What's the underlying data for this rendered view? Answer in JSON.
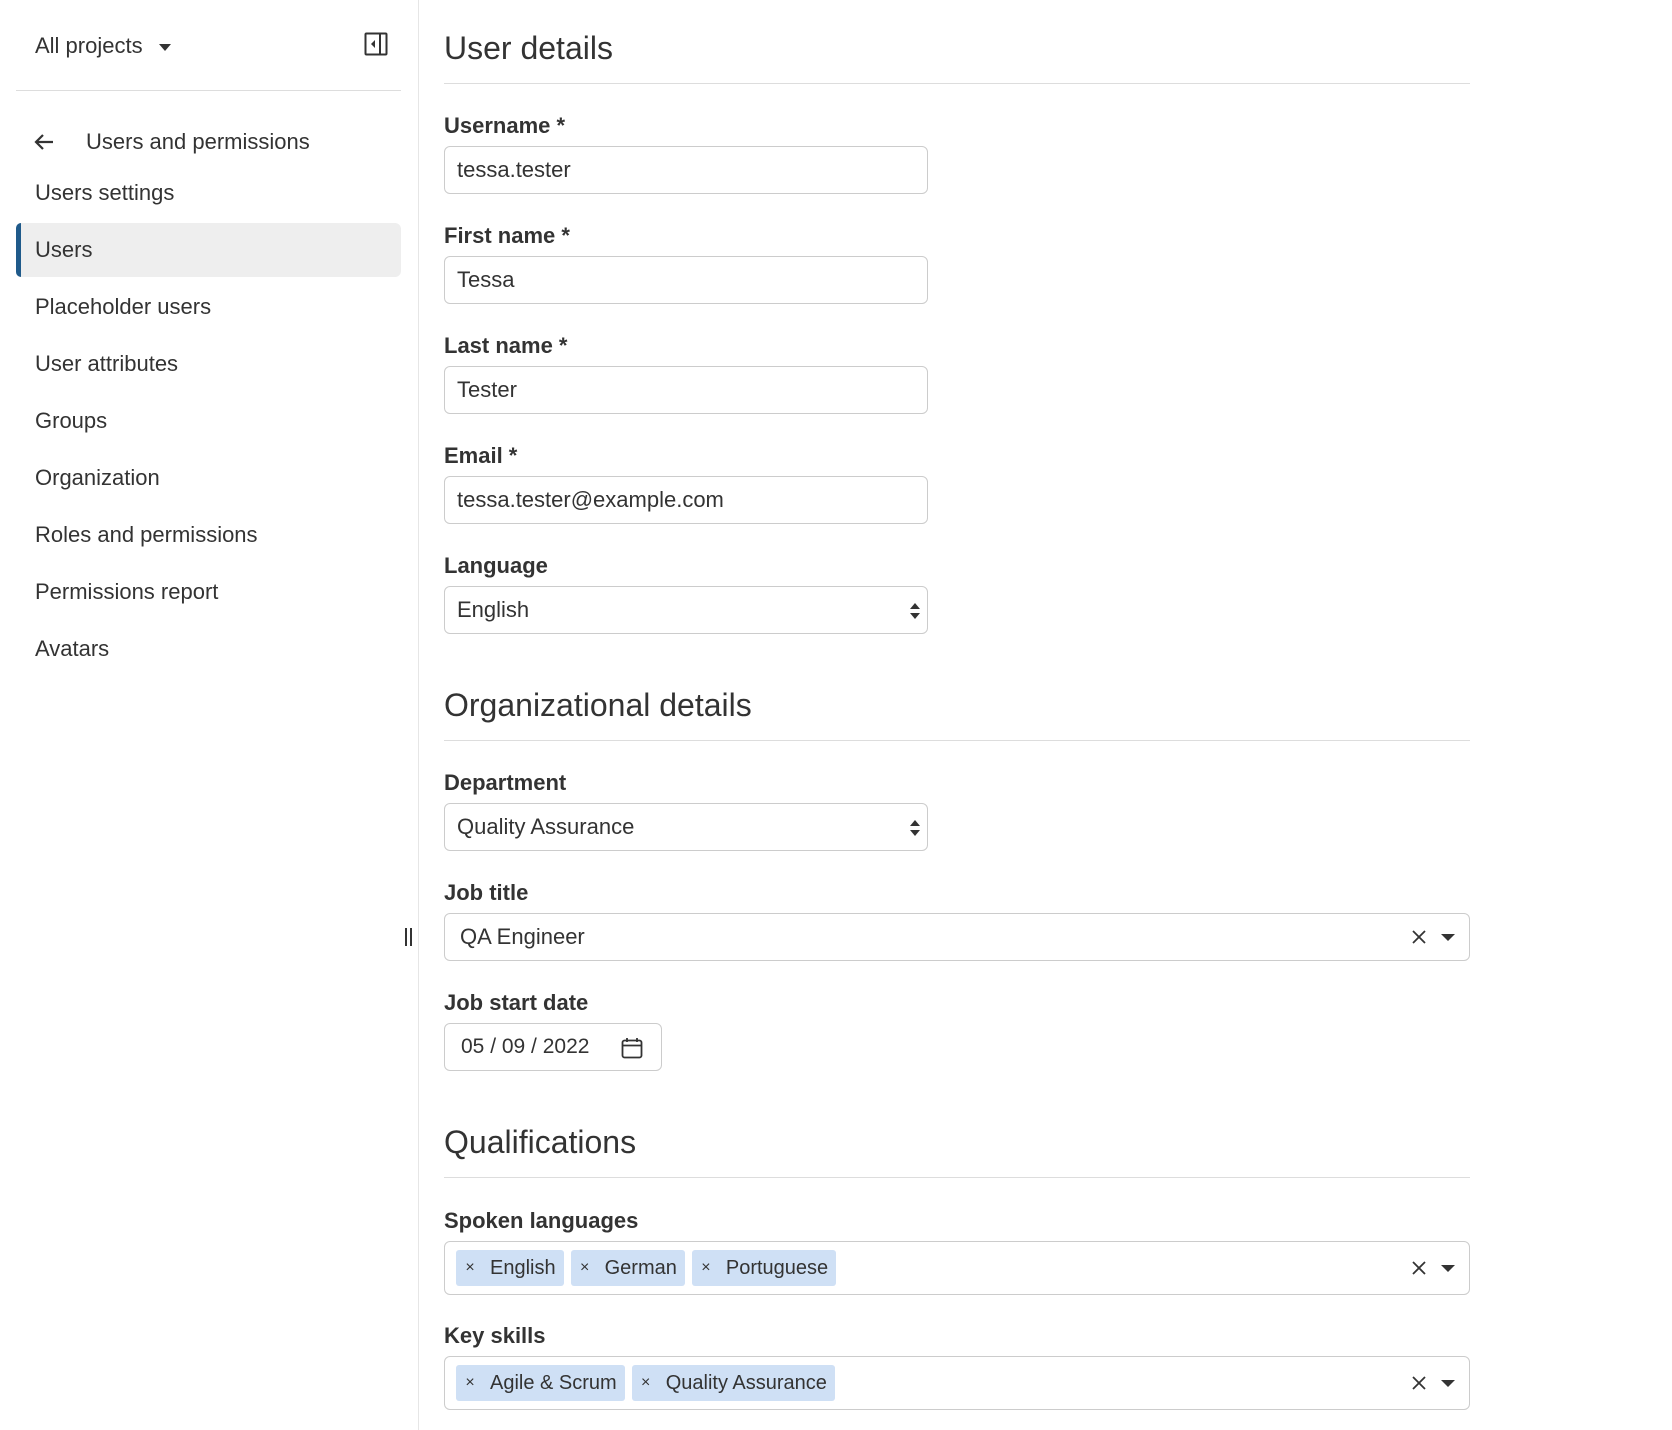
{
  "sidebar": {
    "project_selector": "All projects",
    "back_link": "Users and permissions",
    "items": [
      {
        "label": "Users settings",
        "active": false
      },
      {
        "label": "Users",
        "active": true
      },
      {
        "label": "Placeholder users",
        "active": false
      },
      {
        "label": "User attributes",
        "active": false
      },
      {
        "label": "Groups",
        "active": false
      },
      {
        "label": "Organization",
        "active": false
      },
      {
        "label": "Roles and permissions",
        "active": false
      },
      {
        "label": "Permissions report",
        "active": false
      },
      {
        "label": "Avatars",
        "active": false
      }
    ]
  },
  "user_details": {
    "title": "User details",
    "username": {
      "label": "Username *",
      "value": "tessa.tester"
    },
    "first_name": {
      "label": "First name *",
      "value": "Tessa"
    },
    "last_name": {
      "label": "Last name *",
      "value": "Tester"
    },
    "email": {
      "label": "Email *",
      "value": "tessa.tester@example.com"
    },
    "language": {
      "label": "Language",
      "value": "English"
    }
  },
  "organizational_details": {
    "title": "Organizational details",
    "department": {
      "label": "Department",
      "value": "Quality Assurance"
    },
    "job_title": {
      "label": "Job title",
      "value": "QA Engineer"
    },
    "job_start_date": {
      "label": "Job start date",
      "value": "05 / 09 / 2022"
    }
  },
  "qualifications": {
    "title": "Qualifications",
    "spoken_languages": {
      "label": "Spoken languages",
      "tags": [
        "English",
        "German",
        "Portuguese"
      ]
    },
    "key_skills": {
      "label": "Key skills",
      "tags": [
        "Agile & Scrum",
        "Quality Assurance"
      ]
    }
  },
  "icons": {
    "tag_remove": "×",
    "collapse": "sidebar-collapse-icon",
    "back": "arrow-left-icon",
    "calendar": "calendar-icon"
  },
  "colors": {
    "active_indicator": "#1f5a8a",
    "tag_background": "#cfe0f5",
    "active_background": "#eeeeee"
  }
}
